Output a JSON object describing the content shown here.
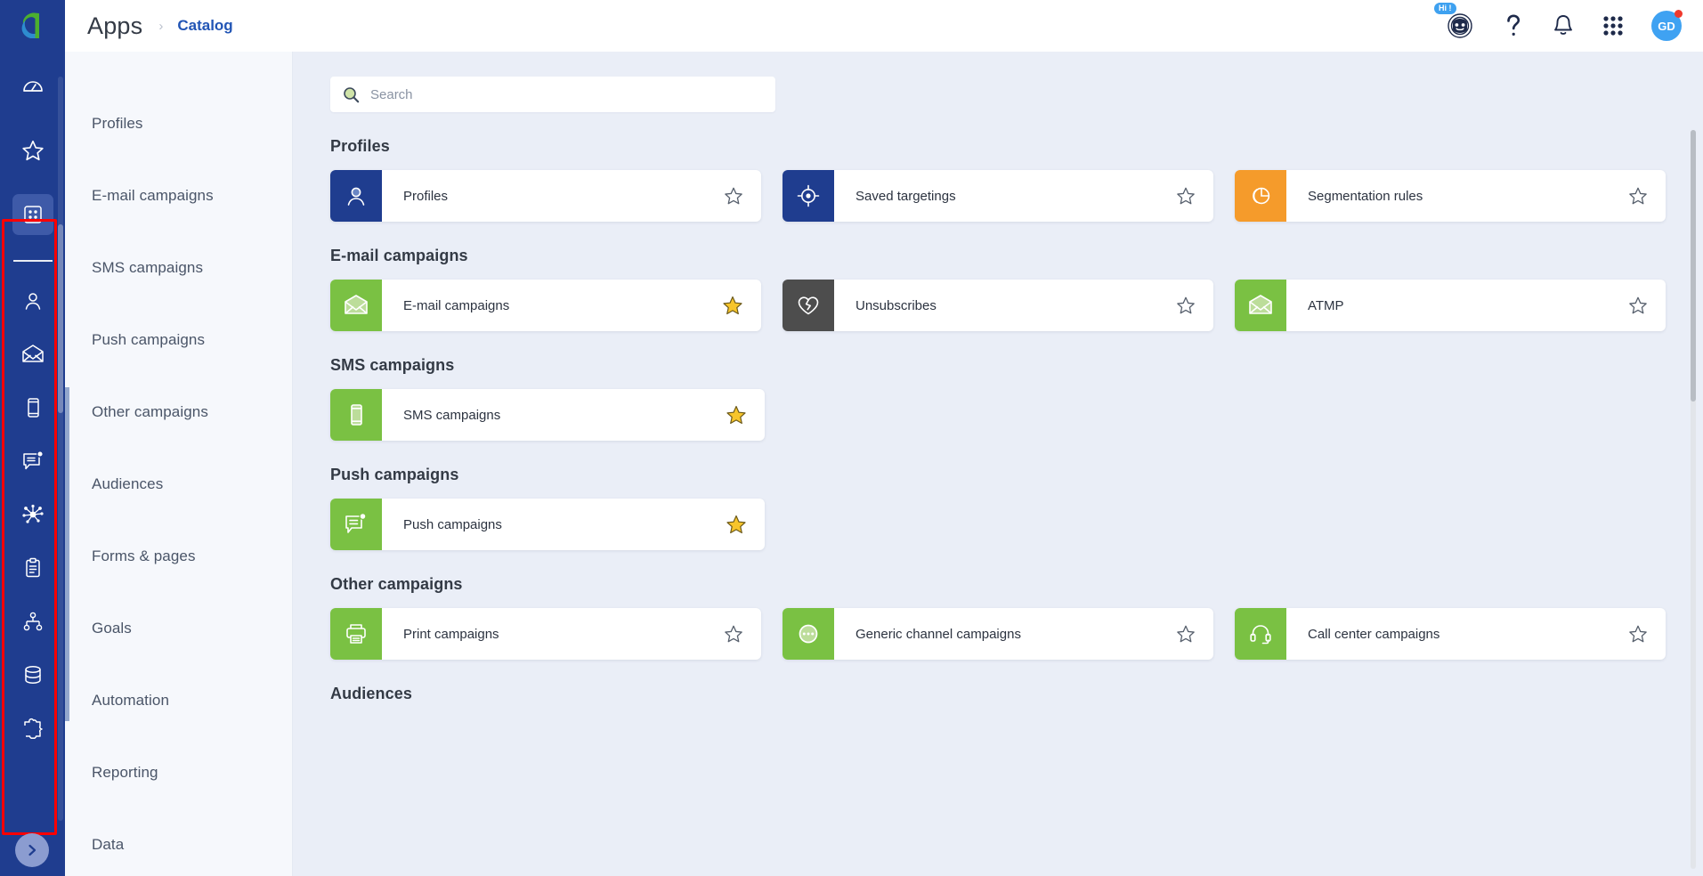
{
  "header": {
    "title": "Apps",
    "breadcrumb_separator": "›",
    "breadcrumb": "Catalog",
    "bot_badge": "Hi !",
    "bot_icon": "chatbot-icon",
    "help_icon": "question-mark-icon",
    "bell_icon": "bell-icon",
    "grid_icon": "apps-grid-icon",
    "avatar_initials": "GD"
  },
  "rail": {
    "logo": "adobe-campaign-logo",
    "top_items": [
      {
        "name": "dashboard-icon"
      },
      {
        "name": "star-icon"
      },
      {
        "name": "apps-grid-icon",
        "active": true
      }
    ],
    "group_items": [
      {
        "name": "profiles-person-icon"
      },
      {
        "name": "email-envelope-icon"
      },
      {
        "name": "sms-phone-icon"
      },
      {
        "name": "push-message-icon"
      },
      {
        "name": "audiences-network-icon"
      },
      {
        "name": "forms-clipboard-icon"
      },
      {
        "name": "automation-workflow-icon"
      },
      {
        "name": "data-database-icon"
      },
      {
        "name": "integrations-puzzle-icon"
      }
    ],
    "expand_icon": "chevron-right-icon",
    "highlight_color": "#ff0000"
  },
  "subnav": {
    "items": [
      {
        "label": "Profiles"
      },
      {
        "label": "E-mail campaigns"
      },
      {
        "label": "SMS campaigns"
      },
      {
        "label": "Push campaigns"
      },
      {
        "label": "Other campaigns"
      },
      {
        "label": "Audiences"
      },
      {
        "label": "Forms & pages"
      },
      {
        "label": "Goals"
      },
      {
        "label": "Automation"
      },
      {
        "label": "Reporting"
      },
      {
        "label": "Data"
      }
    ]
  },
  "search": {
    "icon": "search-icon",
    "placeholder": "Search",
    "value": ""
  },
  "colors": {
    "brand_blue": "#1f3d8f",
    "tile_blue": "#1f3d8f",
    "tile_green": "#7ac143",
    "tile_orange": "#f59b2b",
    "tile_gray": "#4d4d4d",
    "star_gold": "#f7c52b",
    "accent_link": "#2255b5"
  },
  "sections": [
    {
      "title": "Profiles",
      "cards": [
        {
          "label": "Profiles",
          "icon": "person-icon",
          "color": "#1f3d8f",
          "starred": false
        },
        {
          "label": "Saved targetings",
          "icon": "target-crosshair-icon",
          "color": "#1f3d8f",
          "starred": false
        },
        {
          "label": "Segmentation rules",
          "icon": "pie-chart-icon",
          "color": "#f59b2b",
          "starred": false
        }
      ]
    },
    {
      "title": "E-mail campaigns",
      "cards": [
        {
          "label": "E-mail campaigns",
          "icon": "envelope-icon",
          "color": "#7ac143",
          "starred": true
        },
        {
          "label": "Unsubscribes",
          "icon": "broken-heart-icon",
          "color": "#4d4d4d",
          "starred": false
        },
        {
          "label": "ATMP",
          "icon": "envelope-icon",
          "color": "#7ac143",
          "starred": false
        }
      ]
    },
    {
      "title": "SMS campaigns",
      "cards": [
        {
          "label": "SMS campaigns",
          "icon": "mobile-phone-icon",
          "color": "#7ac143",
          "starred": true
        }
      ]
    },
    {
      "title": "Push campaigns",
      "cards": [
        {
          "label": "Push campaigns",
          "icon": "push-message-icon",
          "color": "#7ac143",
          "starred": true
        }
      ]
    },
    {
      "title": "Other campaigns",
      "cards": [
        {
          "label": "Print campaigns",
          "icon": "printer-icon",
          "color": "#7ac143",
          "starred": false
        },
        {
          "label": "Generic channel campaigns",
          "icon": "ellipsis-circle-icon",
          "color": "#7ac143",
          "starred": false
        },
        {
          "label": "Call center campaigns",
          "icon": "headset-icon",
          "color": "#7ac143",
          "starred": false
        }
      ]
    },
    {
      "title": "Audiences",
      "cards": []
    }
  ]
}
